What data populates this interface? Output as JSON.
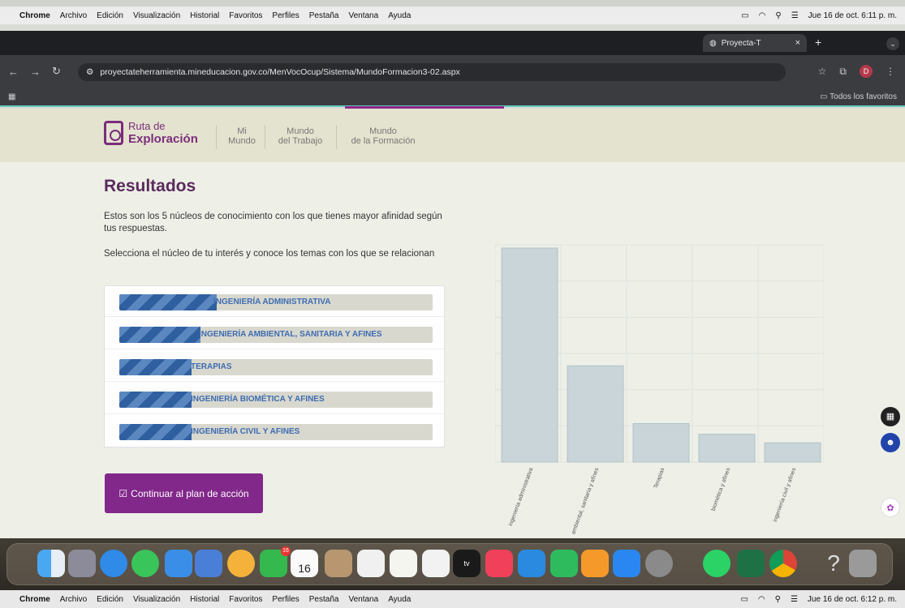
{
  "menubar_top": {
    "app": "Chrome",
    "menus": [
      "Archivo",
      "Edición",
      "Visualización",
      "Historial",
      "Favoritos",
      "Perfiles",
      "Pestaña",
      "Ventana",
      "Ayuda"
    ],
    "datetime": "Jue 16 de oct.  6:11 p. m."
  },
  "menubar_bottom": {
    "app": "Chrome",
    "menus": [
      "Archivo",
      "Edición",
      "Visualización",
      "Historial",
      "Favoritos",
      "Perfiles",
      "Pestaña",
      "Ventana",
      "Ayuda"
    ],
    "datetime": "Jue 16 de oct.  6:12 p. m."
  },
  "browser": {
    "tab_title": "Proyecta-T",
    "url": "proyectateherramienta.mineducacion.gov.co/MenVocOcup/Sistema/MundoFormacion3-02.aspx",
    "bookmarks_all": "Todos los favoritos",
    "profile_initial": "D"
  },
  "site": {
    "logo_line1": "Ruta de",
    "logo_line2": "Exploración",
    "nav": [
      {
        "l1": "Mi",
        "l2": "Mundo"
      },
      {
        "l1": "Mundo",
        "l2": "del Trabajo"
      },
      {
        "l1": "Mundo",
        "l2": "de la Formación"
      }
    ]
  },
  "main": {
    "title": "Resultados",
    "desc1": "Estos son los 5 núcleos de conocimiento con los que tienes mayor afinidad según tus respuestas.",
    "desc2": "Selecciona el núcleo de tu interés y conoce los temas con los que se relacionan",
    "items": [
      {
        "label": "INGENIERÍA ADMINISTRATIVA",
        "fill": 0.31
      },
      {
        "label": "INGENIERÍA AMBIENTAL, SANITARIA Y AFINES",
        "fill": 0.26
      },
      {
        "label": "TERAPIAS",
        "fill": 0.23
      },
      {
        "label": "INGENIERÍA BIOMÉTICA Y AFINES",
        "fill": 0.23
      },
      {
        "label": "INGENIERÍA CIVIL Y AFINES",
        "fill": 0.23
      }
    ],
    "continue_button": "Continuar al plan de acción"
  },
  "chart_data": {
    "type": "bar",
    "categories": [
      "ingeniería administrativa",
      "ambiental, sanitaria y afines",
      "Terapias",
      "biomética y afines",
      "ingeniería civil y afines"
    ],
    "values": [
      100,
      45,
      18,
      13,
      9
    ],
    "grid": true,
    "color": "#c9d5d8"
  },
  "dock": {
    "mail_badge": "16",
    "calendar_month": "OCT.",
    "calendar_day": "16"
  }
}
